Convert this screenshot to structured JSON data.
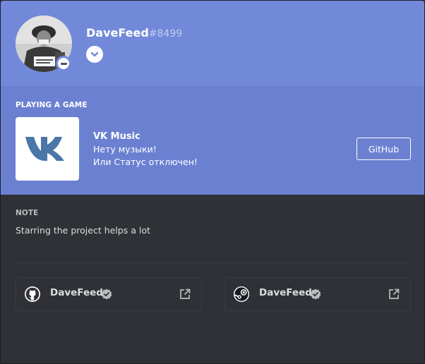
{
  "profile": {
    "username": "DaveFeed",
    "discriminator": "#8499",
    "status": "do-not-disturb",
    "avatar_icon": "avatar-photo",
    "menu_icon": "chevron-down-icon"
  },
  "activity": {
    "title": "PLAYING A GAME",
    "game_name": "VK Music",
    "details": "Нету музыки!",
    "state": "Или Статус отключен!",
    "icon": "vk-logo",
    "button_label": "GitHub"
  },
  "note": {
    "title": "NOTE",
    "text": "Starring the project helps a lot"
  },
  "accounts": [
    {
      "service": "github",
      "name": "DaveFeed",
      "verified": true,
      "icon": "github-icon"
    },
    {
      "service": "steam",
      "name": "DaveFeed",
      "verified": true,
      "icon": "steam-icon"
    }
  ],
  "colors": {
    "header": "#7289da",
    "activity": "#6b80d1",
    "body": "#2f3136",
    "vk_blue": "#4a76a8"
  }
}
